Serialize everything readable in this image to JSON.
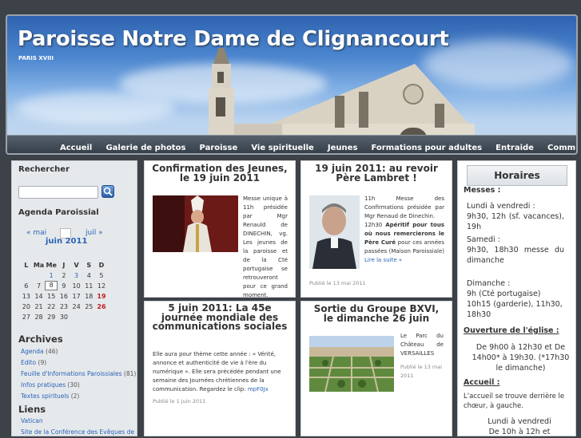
{
  "site": {
    "title": "Paroisse Notre Dame de Clignancourt",
    "subtitle": "PARIS XVIII"
  },
  "nav": {
    "items": [
      "Accueil",
      "Galerie de photos",
      "Paroisse",
      "Vie spirituelle",
      "Jeunes",
      "Formations pour adultes",
      "Entraide",
      "Communautés"
    ]
  },
  "sidebar": {
    "search_heading": "Rechercher",
    "search_placeholder": "",
    "agenda_heading": "Agenda Paroissial",
    "calendar": {
      "prev": "« mai",
      "next": "juil »",
      "month": "juin 2011",
      "days": [
        "L",
        "Ma",
        "Me",
        "J",
        "V",
        "S",
        "D"
      ],
      "weeks": [
        [
          "",
          "",
          "1",
          "2",
          "3",
          "4",
          "5"
        ],
        [
          "6",
          "7",
          "8",
          "9",
          "10",
          "11",
          "12"
        ],
        [
          "13",
          "14",
          "15",
          "16",
          "17",
          "18",
          "19"
        ],
        [
          "20",
          "21",
          "22",
          "23",
          "24",
          "25",
          "26"
        ],
        [
          "27",
          "28",
          "29",
          "30",
          "",
          "",
          ""
        ]
      ],
      "linked_days": [
        "1",
        "3",
        "19",
        "26"
      ],
      "highlight_days": [
        "19",
        "26"
      ],
      "today": "8"
    },
    "archives_heading": "Archives",
    "archives": [
      {
        "label": "Agenda",
        "count": "(46)"
      },
      {
        "label": "Edito",
        "count": "(9)"
      },
      {
        "label": "Feuille d'Informations Paroissiales",
        "count": "(81)"
      },
      {
        "label": "Infos pratiques",
        "count": "(30)"
      },
      {
        "label": "Textes spirituels",
        "count": "(2)"
      }
    ],
    "links_heading": "Liens",
    "links": [
      "Vatican",
      "Site de la Conférence des Evêques de"
    ]
  },
  "posts": [
    {
      "title": "Confirmation des Jeunes, le 19 juin 2011",
      "text": "Messe unique à 11h présidée par Mgr Renauld de DINECHIN, vg. Les jeunes de la paroisse et de la Cté portugaise se retrouveront pour ce grand moment.",
      "date": ""
    },
    {
      "title": "19 juin 2011: au revoir Père Lambret !",
      "text_1": "11h Messe des Confirmations présidée par Mgr Renaud de Dinechin.",
      "text_2": "12h30 ",
      "text_bold": "Apéritif pour tous où nous remercierons le Père Curé",
      "text_3": " pour ces années passées (Maison Paroissiale) ",
      "more": "Lire la suite »",
      "date": "Publié le 13 mai 2011"
    },
    {
      "title": "5 juin 2011: La 45e journée mondiale des communications sociales",
      "text": "Elle aura pour thème cette année : « Vérité, annonce et authenticité de vie à l'ère du numérique ». Elle sera précédée pendant une semaine des Journées chrétiennes de la communication. Regardez le clip: ",
      "clip": "mpF0Jx",
      "date": "Publié le 1 juin 2011"
    },
    {
      "title": "Sortie du Groupe BXVI, le dimanche 26 juin",
      "text": "Le Parc du Château de VERSAILLES",
      "date": "Publié le 13 mai 2011"
    }
  ],
  "horaires": {
    "title": "Horaires",
    "messes_heading": "Messes :",
    "semaine_label": "Lundi à vendredi :",
    "semaine_times": "9h30, 12h (sf. vacances), 19h",
    "samedi_label": "Samedi :",
    "samedi_times": "9h30, 18h30 messe du dimanche",
    "dimanche_label": "Dimanche :",
    "dimanche_times": "9h (Cté portugaise) 10h15 (garderie), 11h30, 18h30",
    "ouverture_heading": "Ouverture de l'église :",
    "ouverture_times": "De 9h00 à 12h30 et De 14h00* à 19h30. (*17h30 le dimanche)",
    "accueil_heading": "Accueil :",
    "accueil_text": "L'accueil se trouve derrière le chœur, à gauche.",
    "accueil_days": "Lundi à vendredi",
    "accueil_hours": "De 10h à 12h et"
  },
  "colors": {
    "link": "#2a63b5",
    "accent_red": "#c02020",
    "background": "#3d4248"
  }
}
